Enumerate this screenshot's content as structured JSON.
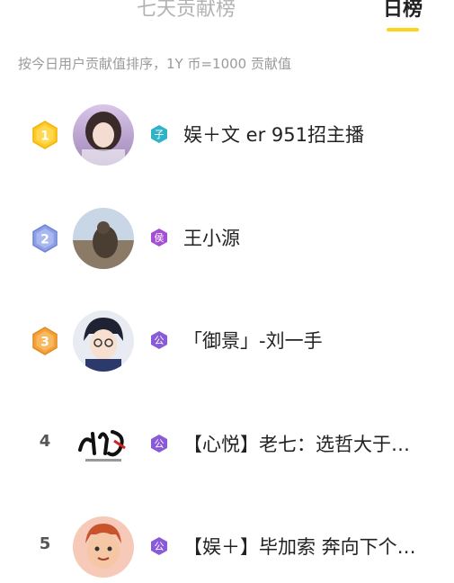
{
  "tabs": {
    "seven_day": "七天贡献榜",
    "daily": "日榜"
  },
  "subtitle": "按今日用户贡献值排序，1Y 币=1000 贡献值",
  "colors": {
    "accent": "#ffd21e",
    "rank1": "#ffc928",
    "rank2": "#8e9fe6",
    "rank3": "#f4a13a",
    "level_purple": "#8a5bd8",
    "level_teal": "#2fb3c6"
  },
  "entries": [
    {
      "rank": "1",
      "level_char": "子",
      "name": "娱＋文 er 951招主播"
    },
    {
      "rank": "2",
      "level_char": "侯",
      "name": "王小源"
    },
    {
      "rank": "3",
      "level_char": "公",
      "name": "「御景」-刘一手"
    },
    {
      "rank": "4",
      "level_char": "公",
      "name": "【心悦】老七：选哲大于…"
    },
    {
      "rank": "5",
      "level_char": "公",
      "name": "【娱＋】毕加索 奔向下个…"
    }
  ]
}
